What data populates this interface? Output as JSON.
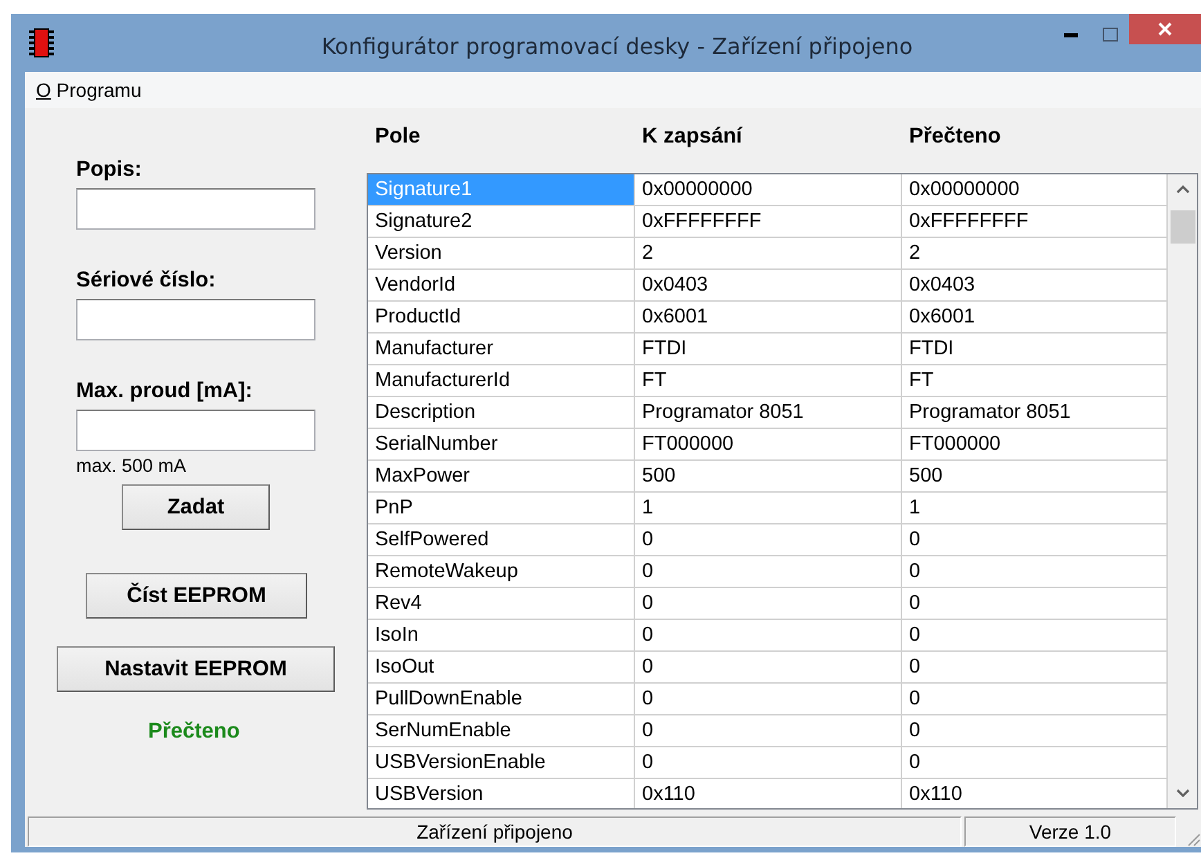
{
  "window": {
    "title": "Konfigurátor programovací desky - Zařízení připojeno"
  },
  "menu": [
    {
      "label": "O Programu"
    }
  ],
  "form": {
    "fields": [
      {
        "label": "Popis:"
      },
      {
        "label": "Sériové číslo:"
      },
      {
        "label": "Max. proud [mA]:",
        "note": "max. 500 mA"
      }
    ],
    "submit": "Zadat",
    "read_button": "Číst EEPROM",
    "write_button": "Nastavit EEPROM",
    "status": "Přečteno"
  },
  "table": {
    "columns": [
      "Pole",
      "K zapsání",
      "Přečteno"
    ],
    "rows": [
      {
        "cells": [
          "Signature1",
          "0x00000000",
          "0x00000000"
        ],
        "selected": true
      },
      {
        "cells": [
          "Signature2",
          "0xFFFFFFFF",
          "0xFFFFFFFF"
        ],
        "selected": false
      },
      {
        "cells": [
          "Version",
          "2",
          "2"
        ],
        "selected": false
      },
      {
        "cells": [
          "VendorId",
          "0x0403",
          "0x0403"
        ],
        "selected": false
      },
      {
        "cells": [
          "ProductId",
          "0x6001",
          "0x6001"
        ],
        "selected": false
      },
      {
        "cells": [
          "Manufacturer",
          "FTDI",
          "FTDI"
        ],
        "selected": false
      },
      {
        "cells": [
          "ManufacturerId",
          "FT",
          "FT"
        ],
        "selected": false
      },
      {
        "cells": [
          "Description",
          "Programator 8051",
          "Programator 8051"
        ],
        "selected": false
      },
      {
        "cells": [
          "SerialNumber",
          "FT000000",
          "FT000000"
        ],
        "selected": false
      },
      {
        "cells": [
          "MaxPower",
          "500",
          "500"
        ],
        "selected": false
      },
      {
        "cells": [
          "PnP",
          "1",
          "1"
        ],
        "selected": false
      },
      {
        "cells": [
          "SelfPowered",
          "0",
          "0"
        ],
        "selected": false
      },
      {
        "cells": [
          "RemoteWakeup",
          "0",
          "0"
        ],
        "selected": false
      },
      {
        "cells": [
          "Rev4",
          "0",
          "0"
        ],
        "selected": false
      },
      {
        "cells": [
          "IsoIn",
          "0",
          "0"
        ],
        "selected": false
      },
      {
        "cells": [
          "IsoOut",
          "0",
          "0"
        ],
        "selected": false
      },
      {
        "cells": [
          "PullDownEnable",
          "0",
          "0"
        ],
        "selected": false
      },
      {
        "cells": [
          "SerNumEnable",
          "0",
          "0"
        ],
        "selected": false
      },
      {
        "cells": [
          "USBVersionEnable",
          "0",
          "0"
        ],
        "selected": false
      },
      {
        "cells": [
          "USBVersion",
          "0x110",
          "0x110"
        ],
        "selected": false
      }
    ]
  },
  "status_bar": [
    "Zařízení připojeno",
    "Verze 1.0"
  ]
}
